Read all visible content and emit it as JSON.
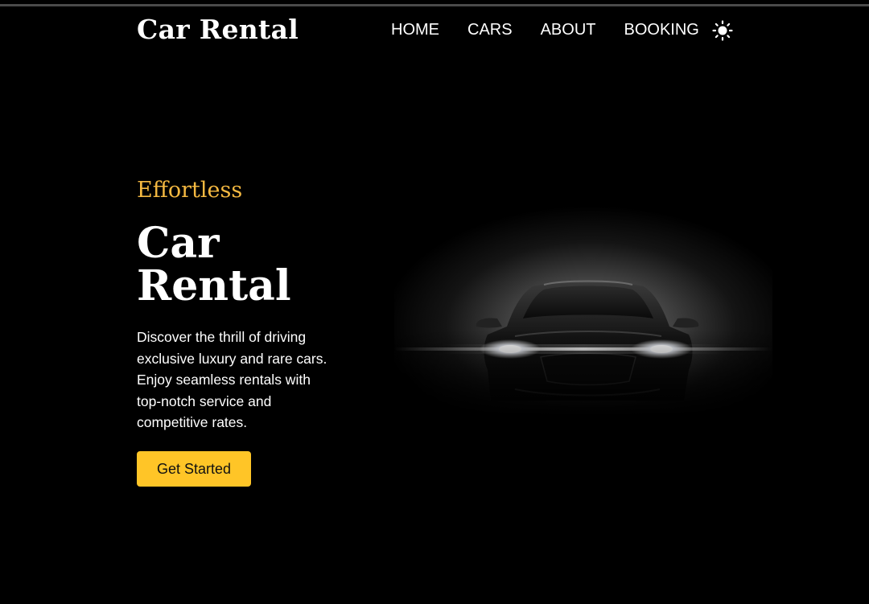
{
  "header": {
    "logo": "Car Rental",
    "nav": [
      "HOME",
      "CARS",
      "ABOUT",
      "BOOKING"
    ],
    "theme_icon": "sun-icon"
  },
  "hero": {
    "tagline": "Effortless",
    "title": "Car Rental",
    "description": "Discover the thrill of driving exclusive luxury and rare cars. Enjoy seamless rentals with top-notch service and competitive rates.",
    "cta_label": "Get Started",
    "image": "car-headlights-illustration"
  },
  "colors": {
    "background": "#000000",
    "accent": "#f5b941",
    "button": "#ffc527",
    "text": "#ffffff"
  }
}
